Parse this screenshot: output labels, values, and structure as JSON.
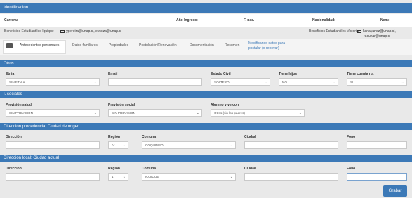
{
  "header": {
    "title": "Identificación"
  },
  "ident": {
    "carrera": "Carrera:",
    "anio_ingreso": "Año Ingreso:",
    "f_nac": "F. nac.",
    "nacionalidad": "Nacionalidad:",
    "nem": "Nem:"
  },
  "contacts": {
    "left_label": "Beneficios Estudiantiles Iquique",
    "left_email": "ypereira@unap.cl, evsoza@unap.cl",
    "right_label": "Beneficios Estudiantiles Victoria",
    "right_email_1": "karlayanez@unap.cl,",
    "right_email_2": "racunar@unap.cl"
  },
  "tabs": [
    {
      "label": "Antecedentes personales"
    },
    {
      "label": "Datos familiares"
    },
    {
      "label": "Propiedades"
    },
    {
      "label": "Postulación/Renovación"
    },
    {
      "label": "Documentación"
    },
    {
      "label": "Resumen"
    },
    {
      "label": "Modificando datos para"
    },
    {
      "label": "postular (o renovar)"
    }
  ],
  "otros": {
    "title": "Otros",
    "etnia_label": "Etnia",
    "etnia_value": "SIN ETNIA",
    "email_label": "Email",
    "email_value": "",
    "estado_civil_label": "Estado Civil",
    "estado_civil_value": "SOLTERO",
    "tiene_hijos_label": "Tiene hijos",
    "tiene_hijos_value": "NO",
    "tiene_rut_label": "Tiene cuenta rut",
    "tiene_rut_value": "SI"
  },
  "sociales": {
    "title": "I. sociales",
    "salud_label": "Previsión salud",
    "salud_value": "SIN PREVISION",
    "social_label": "Previsión social",
    "social_value": "SIN PREVISION",
    "vive_label": "Alumno vive con",
    "vive_value": "Otros (sin los padres)"
  },
  "procedencia": {
    "title": "Dirección procedencia: Ciudad de origen",
    "direccion_label": "Dirección",
    "region_label": "Región",
    "region_value": "IV",
    "comuna_label": "Comuna",
    "comuna_value": "COQUIMBO",
    "ciudad_label": "Ciudad",
    "fono_label": "Fono"
  },
  "local": {
    "title": "Dirección local: Ciudad actual",
    "direccion_label": "Dirección",
    "region_label": "Región",
    "region_value": "1",
    "comuna_label": "Comuna",
    "comuna_value": "IQUIQUE",
    "ciudad_label": "Ciudad",
    "fono_label": "Fono"
  },
  "grabar_label": "Grabar"
}
